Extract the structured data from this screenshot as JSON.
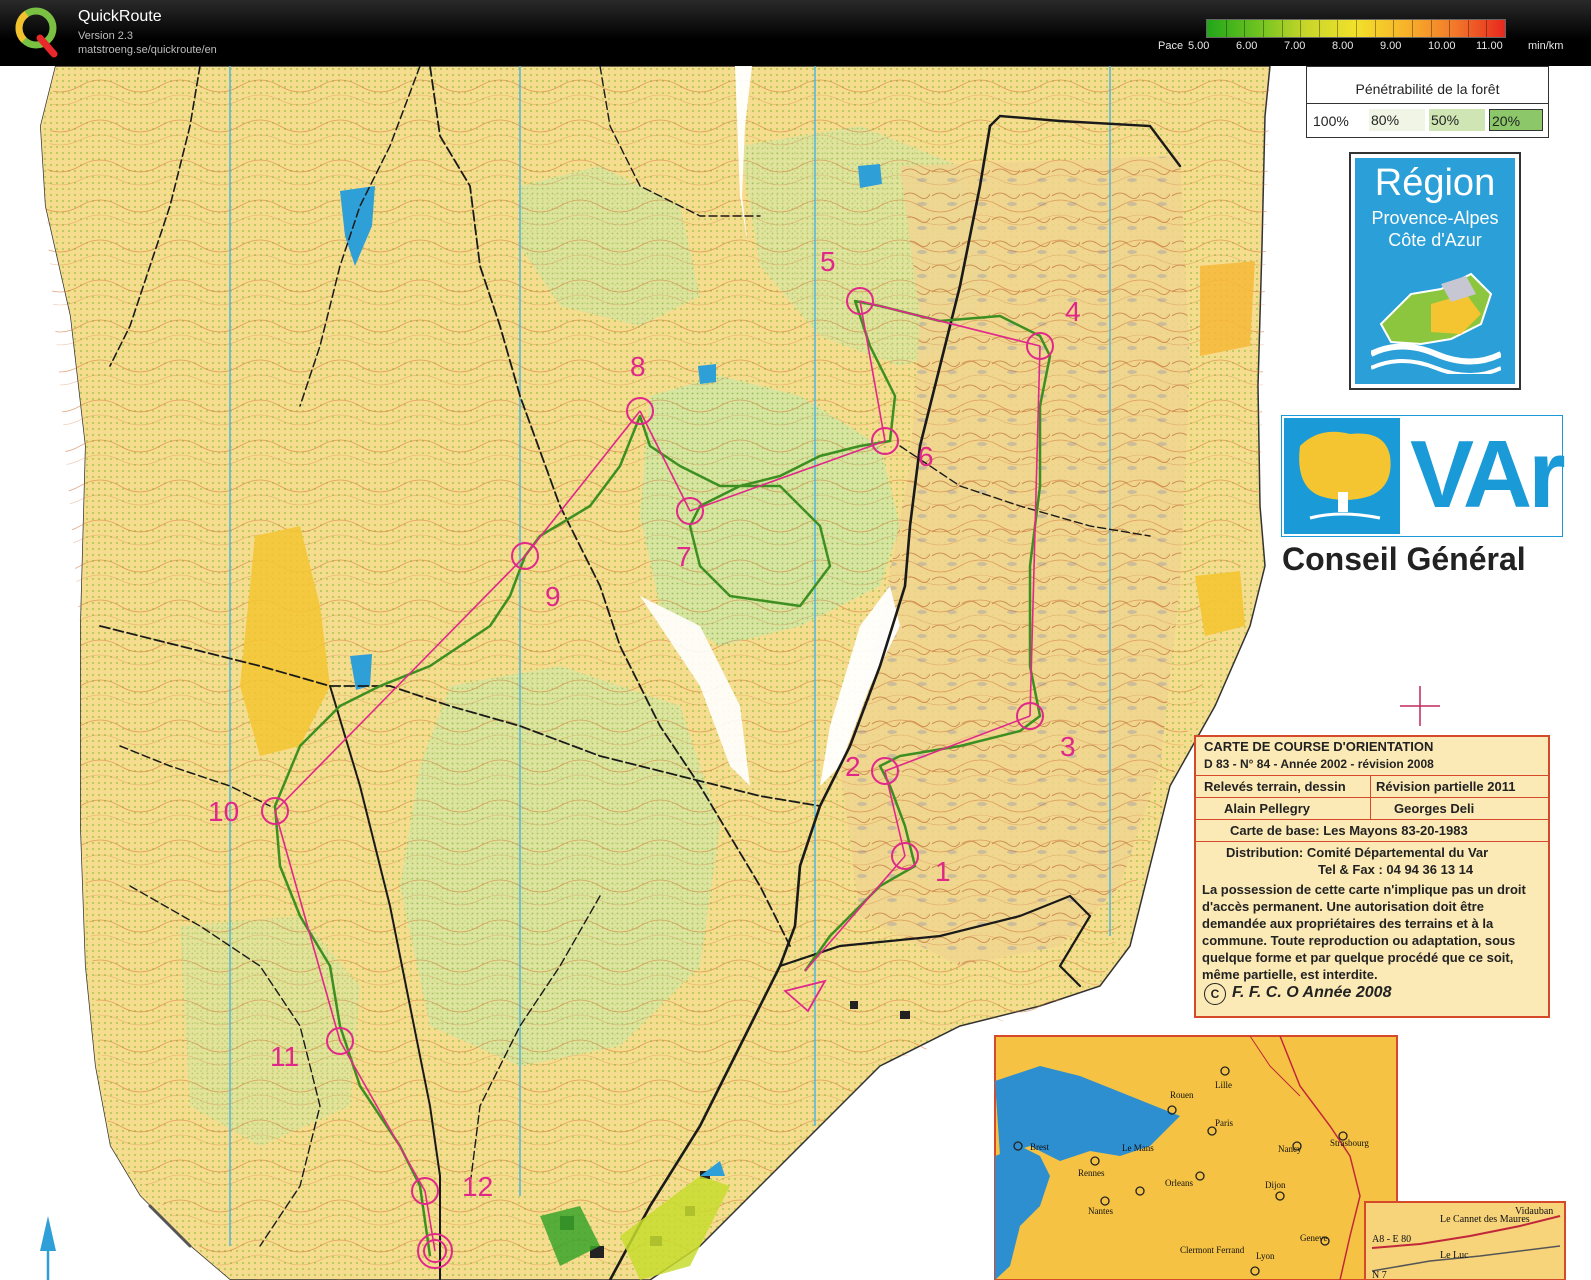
{
  "app": {
    "title": "QuickRoute",
    "version": "Version 2.3",
    "url": "matstroeng.se/quickroute/en"
  },
  "pace_legend": {
    "label": "Pace",
    "ticks": [
      "5.00",
      "6.00",
      "7.00",
      "8.00",
      "9.00",
      "10.00",
      "11.00"
    ],
    "unit": "min/km",
    "colors": [
      "#22a61a",
      "#6cc21f",
      "#c8d62a",
      "#f2e12a",
      "#f7b32a",
      "#f2772a",
      "#e8281e"
    ]
  },
  "map": {
    "controls": [
      "1",
      "2",
      "3",
      "4",
      "5",
      "6",
      "7",
      "8",
      "9",
      "10",
      "11",
      "12"
    ],
    "course_color": "#e0288a",
    "route_color": "#3e8f22",
    "penetrability": {
      "title": "Pénétrabilité de la forêt",
      "levels": [
        "100%",
        "80%",
        "50%",
        "20%"
      ]
    },
    "region_logo": {
      "line1": "Région",
      "line2": "Provence-Alpes",
      "line3": "Côte d'Azur"
    },
    "var_logo": {
      "text": "VAr",
      "subtitle": "Conseil Général"
    },
    "info_box": {
      "title1": "CARTE DE COURSE D'ORIENTATION",
      "title2": "D 83 - N° 84 - Année 2002 - révision 2008",
      "releves": "Relevés  terrain, dessin",
      "revision": "Révision partielle  2011",
      "author1": "Alain Pellegry",
      "author2": "Georges Deli",
      "base": "Carte de base: Les Mayons 83-20-1983",
      "distribution": "Distribution:  Comité Départemental du Var",
      "phone": "Tel & Fax : 04 94 36 13 14",
      "notice": "La possession de cette carte n'implique pas un droit d'accès permanent. Une autorisation doit être demandée aux propriétaires des terrains et à la commune. Toute reproduction ou adaptation, sous quelque forme et par quelque procédé que ce soit, même partielle, est interdite.",
      "ffco": "F. F. C. O Année 2008",
      "copyright": "C"
    },
    "france_map": {
      "cities": [
        "Lille",
        "Rouen",
        "Brest",
        "Le Mans",
        "Paris",
        "Nancy",
        "Strasbourg",
        "Rennes",
        "Orleans",
        "Dijon",
        "Nantes",
        "Geneve",
        "Clermont Ferrand",
        "Lyon"
      ]
    },
    "inset_map": {
      "labels": [
        "Le Cannet des Maures",
        "Vidauban",
        "A8 - E 80",
        "Le Luc",
        "N 7"
      ]
    }
  }
}
